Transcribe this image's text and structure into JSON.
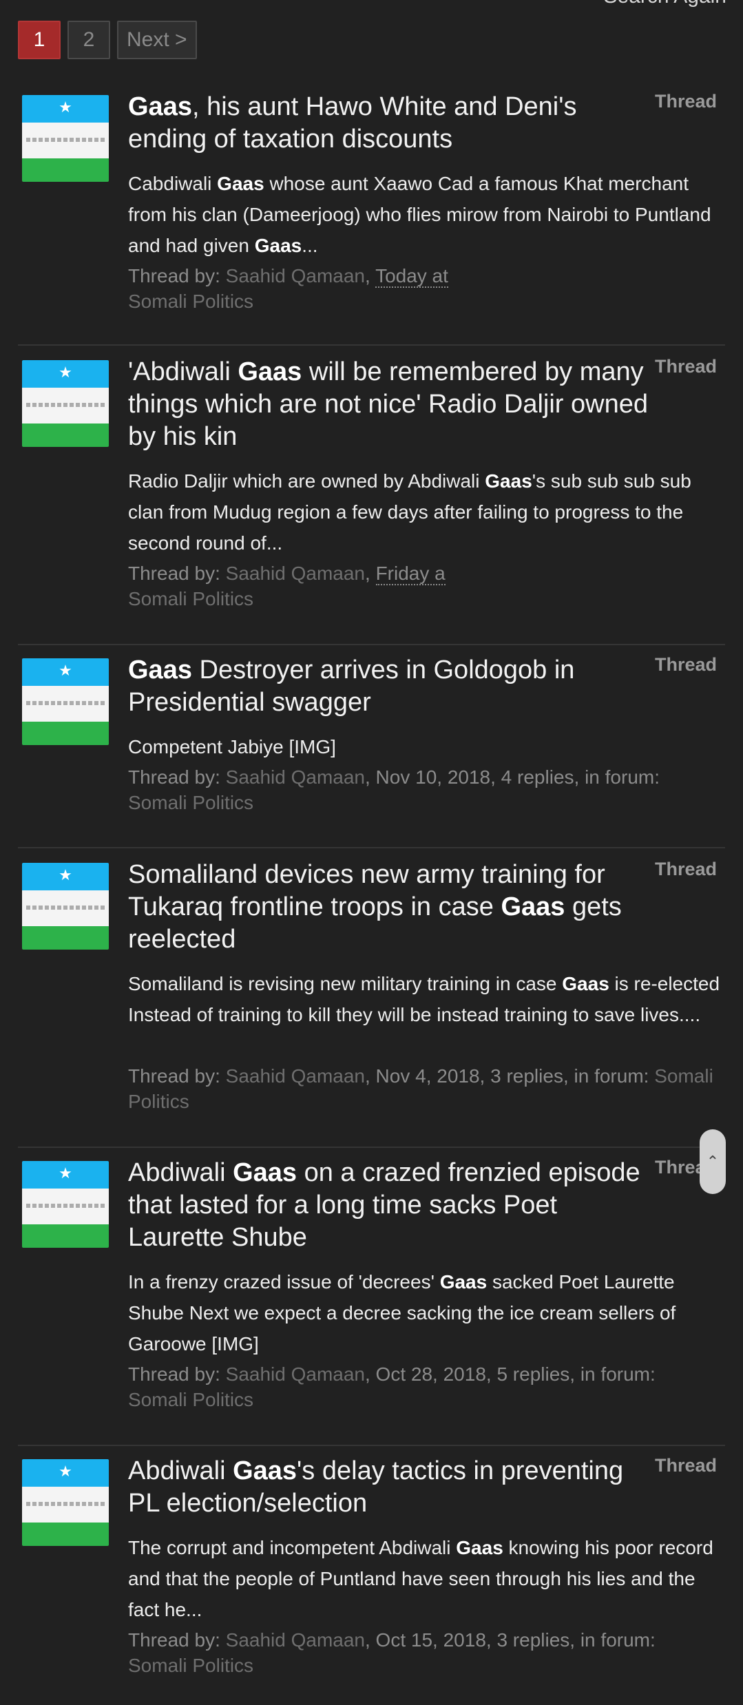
{
  "header": {
    "search_again": "Search Again"
  },
  "pagination": {
    "page1": "1",
    "page2": "2",
    "next": "Next >"
  },
  "results": [
    {
      "type": "Thread",
      "title_pre": "",
      "title_bold": "Gaas",
      "title_post": ", his aunt Hawo White and Deni's ending of taxation discounts",
      "snippet_pre": "Cabdiwali ",
      "snippet_bold": "Gaas",
      "snippet_mid": " whose aunt Xaawo Cad a famous Khat merchant from his clan (Dameerjoog) who flies mirow from Nairobi to Puntland and had given ",
      "snippet_bold2": "Gaas",
      "snippet_post": "...",
      "by": "Thread by: ",
      "author": "Saahid Qamaan",
      "date": "Today at",
      "stats": "",
      "forum": "Somali Politics"
    },
    {
      "type": "Thread",
      "title_pre": "'Abdiwali ",
      "title_bold": "Gaas",
      "title_post": " will be remembered by many things which are not nice' Radio Daljir owned by his kin",
      "snippet_pre": "Radio Daljir which are owned by Abdiwali ",
      "snippet_bold": "Gaas",
      "snippet_mid": "'s sub sub sub sub clan from Mudug region a few days after failing to progress to the second round of...",
      "snippet_bold2": "",
      "snippet_post": "",
      "by": "Thread by: ",
      "author": "Saahid Qamaan",
      "date": "Friday a",
      "stats": "",
      "forum": "Somali Politics"
    },
    {
      "type": "Thread",
      "title_pre": "",
      "title_bold": "Gaas",
      "title_post": " Destroyer arrives in Goldogob in Presidential swagger",
      "snippet_pre": "Competent Jabiye [IMG]",
      "snippet_bold": "",
      "snippet_mid": "",
      "snippet_bold2": "",
      "snippet_post": "",
      "by": "Thread by: ",
      "author": "Saahid Qamaan",
      "date": "",
      "stats": ", Nov 10, 2018, 4 replies, in forum:",
      "forum": "Somali Politics"
    },
    {
      "type": "Thread",
      "title_pre": "Somaliland devices new army training for Tukaraq frontline troops in case ",
      "title_bold": "Gaas",
      "title_post": " gets reelected",
      "snippet_pre": "Somaliland is revising new military training in case ",
      "snippet_bold": "Gaas",
      "snippet_mid": " is re-elected Instead of training to kill they will be instead training to save lives....",
      "snippet_bold2": "",
      "snippet_post": "",
      "by": "Thread by: ",
      "author": "Saahid Qamaan",
      "date": "",
      "stats": ", Nov 4, 2018, 3 replies, in forum:",
      "forum": "Somali Politics"
    },
    {
      "type": "Thread",
      "title_pre": "Abdiwali ",
      "title_bold": "Gaas",
      "title_post": " on a crazed frenzied episode that lasted for a long time sacks Poet Laurette Shube",
      "snippet_pre": "In a frenzy crazed issue of 'decrees' ",
      "snippet_bold": "Gaas",
      "snippet_mid": " sacked Poet Laurette Shube Next we expect a decree sacking the ice cream sellers of Garoowe [IMG]",
      "snippet_bold2": "",
      "snippet_post": "",
      "by": "Thread by: ",
      "author": "Saahid Qamaan",
      "date": "",
      "stats": ", Oct 28, 2018, 5 replies, in forum:",
      "forum": "Somali Politics"
    },
    {
      "type": "Thread",
      "title_pre": "Abdiwali ",
      "title_bold": "Gaas",
      "title_post": "'s delay tactics in preventing PL election/selection",
      "snippet_pre": "The corrupt and incompetent Abdiwali ",
      "snippet_bold": "Gaas",
      "snippet_mid": " knowing his poor record and that the people of Puntland have seen through his lies and the fact he...",
      "snippet_bold2": "",
      "snippet_post": "",
      "by": "Thread by: ",
      "author": "Saahid Qamaan",
      "date": "",
      "stats": ", Oct 15, 2018, 3 replies, in forum:",
      "forum": "Somali Politics"
    }
  ],
  "scroll": {
    "icon": "chevron-up-icon"
  }
}
